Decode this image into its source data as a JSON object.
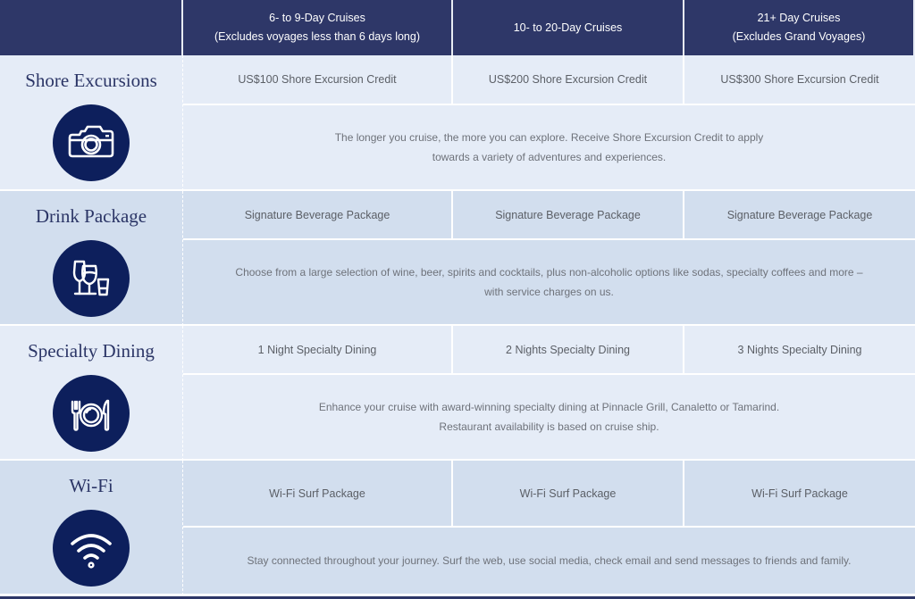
{
  "header": {
    "columns": [
      {
        "line1": "",
        "line2": ""
      },
      {
        "line1": "6- to 9-Day Cruises",
        "line2": "(Excludes voyages less than 6 days long)"
      },
      {
        "line1": "10- to 20-Day Cruises",
        "line2": ""
      },
      {
        "line1": "21+ Day Cruises",
        "line2": "(Excludes Grand Voyages)"
      }
    ]
  },
  "rows": [
    {
      "label": "Shore Excursions",
      "icon": "camera-icon",
      "values": [
        "US$100 Shore Excursion Credit",
        "US$200 Shore Excursion Credit",
        "US$300 Shore Excursion Credit"
      ],
      "description": [
        "The longer you cruise, the more you can explore. Receive Shore Excursion Credit to apply",
        "towards a variety of adventures and experiences."
      ]
    },
    {
      "label": "Drink Package",
      "icon": "drinks-icon",
      "values": [
        "Signature Beverage Package",
        "Signature Beverage Package",
        "Signature Beverage Package"
      ],
      "description": [
        "Choose from a large selection of wine, beer, spirits and cocktails, plus non-alcoholic options like sodas, specialty coffees and more –",
        "with service charges on us."
      ]
    },
    {
      "label": "Specialty Dining",
      "icon": "dining-plate-icon",
      "values": [
        "1 Night Specialty Dining",
        "2 Nights Specialty Dining",
        "3 Nights Specialty Dining"
      ],
      "description": [
        "Enhance your cruise with award-winning specialty dining at Pinnacle Grill, Canaletto or Tamarind.",
        "Restaurant availability is based on cruise ship."
      ]
    },
    {
      "label": "Wi-Fi",
      "icon": "wifi-icon",
      "values": [
        "Wi-Fi Surf Package",
        "Wi-Fi Surf Package",
        "Wi-Fi Surf Package"
      ],
      "description": [
        "Stay connected throughout your journey. Surf the web, use social media, check email and send messages to friends and family."
      ]
    }
  ],
  "colors": {
    "header_bg": "#2e3768",
    "icon_circle": "#0d1f5c",
    "row_light": "#e5ecf7",
    "row_dark": "#d2deee",
    "label_text": "#2b3566",
    "cell_text": "#5b5f66"
  }
}
